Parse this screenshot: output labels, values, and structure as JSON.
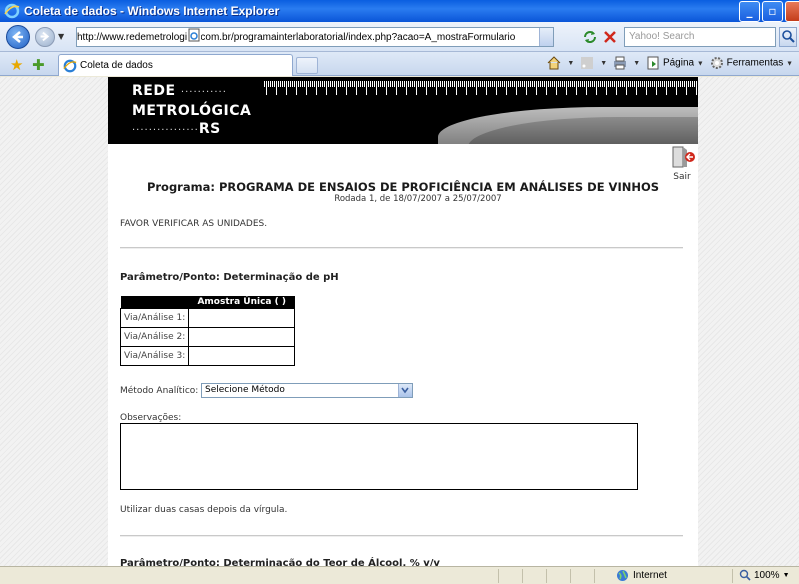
{
  "window": {
    "title": "Coleta de dados - Windows Internet Explorer"
  },
  "address_bar": {
    "url": "http://www.redemetrologica.com.br/programainterlaboratorial/index.php?acao=A_mostraFormulario",
    "search_placeholder": "Yahoo! Search"
  },
  "tabs": [
    {
      "label": "Coleta de dados"
    }
  ],
  "command_bar": {
    "page_label": "Página",
    "tools_label": "Ferramentas"
  },
  "site": {
    "logo_line1": "REDE",
    "logo_line2": "METROLÓGICA",
    "logo_line3": "RS",
    "exit_label": "Sair"
  },
  "program": {
    "title": "Programa: PROGRAMA DE ENSAIOS DE PROFICIÊNCIA EM ANÁLISES DE VINHOS",
    "round": "Rodada 1, de 18/07/2007 a 25/07/2007",
    "notice": "FAVOR VERIFICAR AS UNIDADES."
  },
  "section1": {
    "parameter": "Parâmetro/Ponto: Determinação de pH",
    "table_header": "Amostra Única ( )",
    "rows": [
      "Via/Análise 1:",
      "Via/Análise 2:",
      "Via/Análise 3:"
    ],
    "method_label": "Método Analítico:",
    "method_selected": "Selecione Método",
    "observations_label": "Observações:",
    "hint": "Utilizar duas casas depois da vírgula."
  },
  "section2": {
    "parameter": "Parâmetro/Ponto: Determinação do Teor de Álcool, % v/v"
  },
  "status_bar": {
    "zone": "Internet",
    "zoom": "100%"
  }
}
